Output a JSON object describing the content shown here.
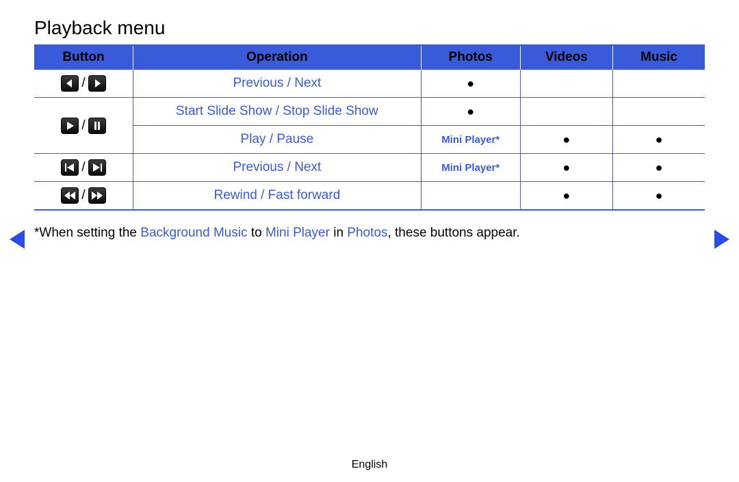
{
  "title": "Playback menu",
  "headers": {
    "button": "Button",
    "operation": "Operation",
    "photos": "Photos",
    "videos": "Videos",
    "music": "Music"
  },
  "rows": [
    {
      "button_icons": [
        "chevron-left",
        "chevron-right"
      ],
      "operation": "Previous / Next",
      "photos": "●",
      "videos": "",
      "music": ""
    },
    {
      "button_icons": [
        "play",
        "pause"
      ],
      "operation": "Start Slide Show / Stop Slide Show",
      "photos": "●",
      "videos": "",
      "music": ""
    },
    {
      "button_icons": null,
      "operation": "Play / Pause",
      "photos_mini": "Mini Player*",
      "videos": "●",
      "music": "●"
    },
    {
      "button_icons": [
        "skip-prev",
        "skip-next"
      ],
      "operation": "Previous / Next",
      "photos_mini": "Mini Player*",
      "videos": "●",
      "music": "●"
    },
    {
      "button_icons": [
        "rewind",
        "fast-forward"
      ],
      "operation": "Rewind / Fast forward",
      "photos": "",
      "videos": "●",
      "music": "●"
    }
  ],
  "footnote": {
    "prefix": "*When setting the ",
    "hl1": "Background Music",
    "mid1": " to ",
    "hl2": "Mini Player",
    "mid2": " in ",
    "hl3": "Photos",
    "suffix": ", these buttons appear."
  },
  "language": "English"
}
